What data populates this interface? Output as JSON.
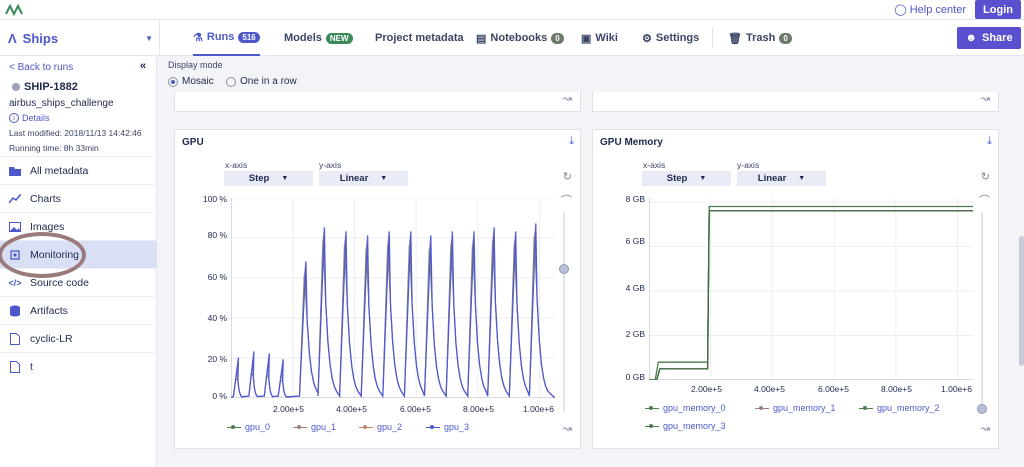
{
  "topbar": {
    "help_label": "Help center",
    "login_label": "Login"
  },
  "nav": {
    "project": "Ships",
    "tabs": [
      {
        "label": "Runs",
        "badge": "516"
      },
      {
        "label": "Models",
        "badge": "NEW"
      },
      {
        "label": "Project metadata"
      },
      {
        "label": "Notebooks",
        "badge": "0"
      },
      {
        "label": "Wiki"
      },
      {
        "label": "Settings"
      },
      {
        "label": "Trash",
        "badge": "0"
      }
    ],
    "share_label": "Share"
  },
  "sidebar": {
    "back_label": "< Back to runs",
    "run_id": "SHIP-1882",
    "run_name": "airbus_ships_challenge",
    "details_label": "Details",
    "last_modified": "Last modified: 2018/11/13 14:42:46",
    "running_time": "Running time: 8h 33min",
    "items": [
      {
        "label": "All metadata"
      },
      {
        "label": "Charts"
      },
      {
        "label": "Images"
      },
      {
        "label": "Monitoring"
      },
      {
        "label": "Source code"
      },
      {
        "label": "Artifacts"
      },
      {
        "label": "cyclic-LR"
      },
      {
        "label": "t"
      }
    ]
  },
  "display_mode": {
    "label": "Display mode",
    "options": [
      "Mosaic",
      "One in a row"
    ],
    "selected": "Mosaic"
  },
  "colors": {
    "accent": "#4d58ca",
    "gpu_0": "#4e7d4e",
    "gpu_1": "#a0807a",
    "gpu_2": "#c28a6a",
    "gpu_3": "#4a55d8"
  },
  "chart_data": [
    {
      "type": "line",
      "title": "GPU",
      "x_axis_label": "x-axis",
      "x_axis_value": "Step",
      "y_axis_label": "y-axis",
      "y_axis_value": "Linear",
      "yticks": [
        "100 %",
        "80 %",
        "60 %",
        "40 %",
        "20 %",
        "0 %"
      ],
      "xticks": [
        "2.00e+5",
        "4.00e+5",
        "6.00e+5",
        "8.00e+5",
        "1.00e+6"
      ],
      "ylim": [
        0,
        100
      ],
      "xlim": [
        0,
        1050000
      ],
      "series": [
        {
          "name": "gpu_0"
        },
        {
          "name": "gpu_1"
        },
        {
          "name": "gpu_2"
        },
        {
          "name": "gpu_3"
        }
      ],
      "peaks": [
        {
          "x": 20000,
          "y": 15
        },
        {
          "x": 70000,
          "y": 18
        },
        {
          "x": 120000,
          "y": 17
        },
        {
          "x": 165000,
          "y": 14
        },
        {
          "x": 240000,
          "y": 65
        },
        {
          "x": 300000,
          "y": 82
        },
        {
          "x": 370000,
          "y": 80
        },
        {
          "x": 440000,
          "y": 78
        },
        {
          "x": 510000,
          "y": 80
        },
        {
          "x": 580000,
          "y": 80
        },
        {
          "x": 645000,
          "y": 78
        },
        {
          "x": 715000,
          "y": 80
        },
        {
          "x": 785000,
          "y": 80
        },
        {
          "x": 850000,
          "y": 82
        },
        {
          "x": 920000,
          "y": 80
        },
        {
          "x": 985000,
          "y": 84
        }
      ]
    },
    {
      "type": "line",
      "title": "GPU Memory",
      "x_axis_label": "x-axis",
      "x_axis_value": "Step",
      "y_axis_label": "y-axis",
      "y_axis_value": "Linear",
      "yticks": [
        "8 GB",
        "6 GB",
        "4 GB",
        "2 GB",
        "0 GB"
      ],
      "xticks": [
        "2.00e+5",
        "4.00e+5",
        "6.00e+5",
        "8.00e+5",
        "1.00e+6"
      ],
      "ylim": [
        0,
        8
      ],
      "xlim": [
        0,
        1050000
      ],
      "series": [
        {
          "name": "gpu_memory_0",
          "points": [
            [
              0,
              0
            ],
            [
              20000,
              0
            ],
            [
              30000,
              0.8
            ],
            [
              190000,
              0.8
            ],
            [
              195000,
              7.8
            ],
            [
              1050000,
              7.8
            ]
          ]
        },
        {
          "name": "gpu_memory_1",
          "points": [
            [
              0,
              0
            ],
            [
              25000,
              0
            ],
            [
              35000,
              0.5
            ],
            [
              190000,
              0.5
            ],
            [
              195000,
              7.6
            ],
            [
              1050000,
              7.6
            ]
          ]
        },
        {
          "name": "gpu_memory_2",
          "points": [
            [
              0,
              0
            ],
            [
              25000,
              0
            ],
            [
              35000,
              0.5
            ],
            [
              190000,
              0.5
            ],
            [
              195000,
              7.6
            ],
            [
              1050000,
              7.6
            ]
          ]
        },
        {
          "name": "gpu_memory_3",
          "points": [
            [
              0,
              0
            ],
            [
              25000,
              0
            ],
            [
              35000,
              0.5
            ],
            [
              190000,
              0.5
            ],
            [
              195000,
              7.6
            ],
            [
              1050000,
              7.6
            ]
          ]
        }
      ]
    }
  ]
}
